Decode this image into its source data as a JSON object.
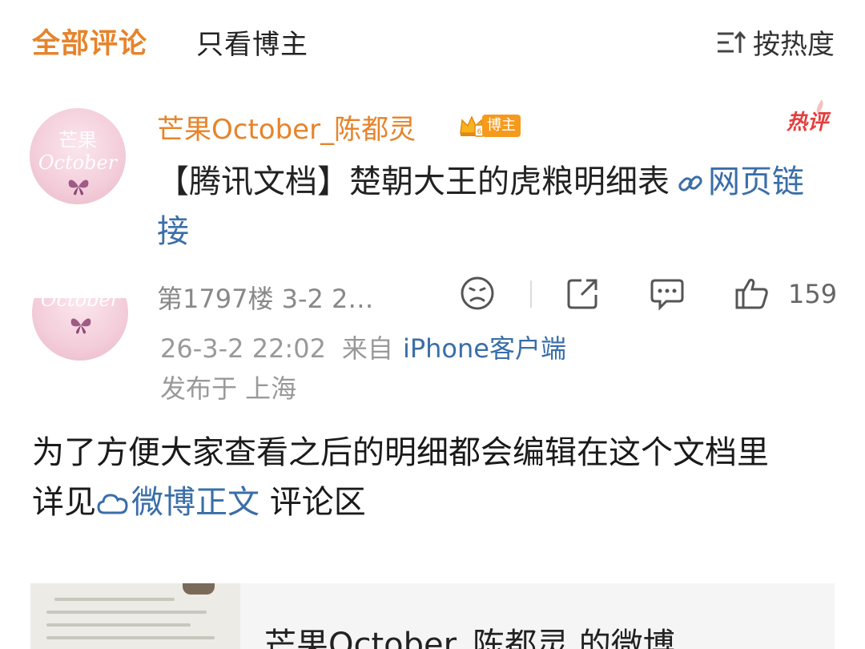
{
  "tabs": {
    "all_comments": "全部评论",
    "blogger_only": "只看博主",
    "sort_label": "按热度"
  },
  "avatar": {
    "top_text": "芒果",
    "mid_text": "October"
  },
  "comment": {
    "username": "芒果October_陈都灵",
    "badge": "博主",
    "hot_tag": "热评",
    "text_main": "【腾讯文档】楚朝大王的虎粮明细表",
    "link_text": "网页链接",
    "floor": "第1797楼 3-2 2…",
    "like_count": "159"
  },
  "meta": {
    "time": "26-3-2 22:02",
    "from": "来自",
    "source": "iPhone客户端",
    "location": "发布于 上海"
  },
  "body": {
    "line1": "为了方便大家查看之后的明细都会编辑在这个文档里",
    "see_prefix": "详见",
    "weibo_link": "微博正文",
    "see_suffix": " 评论区"
  },
  "card": {
    "title": "芒果October_陈都灵 的微博"
  },
  "colors": {
    "accent_orange": "#e7832a",
    "link_blue": "#3a6ea8",
    "hot_red": "#e53d3d",
    "badge_orange": "#f59a1d"
  },
  "icons": {
    "sort": "sort-icon",
    "link": "link-icon",
    "dislike": "sad-face-icon",
    "share": "share-icon",
    "reply": "comment-bubble-icon",
    "like": "thumbs-up-icon",
    "weibo": "weibo-cloud-icon",
    "crown": "crown-icon"
  }
}
